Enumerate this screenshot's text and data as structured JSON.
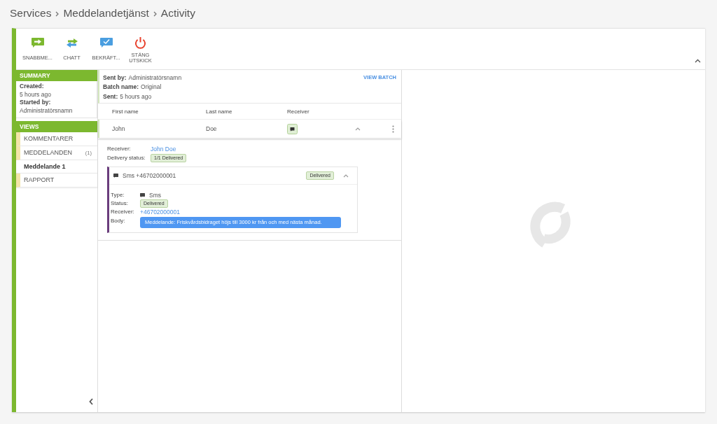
{
  "breadcrumb": [
    {
      "label": "Services"
    },
    {
      "label": "Meddelandetjänst"
    },
    {
      "label": "Activity"
    }
  ],
  "toolbar": {
    "buttons": [
      {
        "label": "SNABBME...",
        "kind": "quick-message"
      },
      {
        "label": "CHATT",
        "kind": "chat"
      },
      {
        "label": "BEKRÄFT...",
        "kind": "confirm"
      },
      {
        "label": "STÄNG UTSKICK",
        "kind": "stop"
      }
    ]
  },
  "sidebar": {
    "summary": {
      "title": "SUMMARY",
      "fields": [
        {
          "label": "Created:",
          "value": "5 hours ago"
        },
        {
          "label": "Started by:",
          "value": "Administratörsnamn"
        }
      ]
    },
    "views": {
      "title": "VIEWS",
      "items": [
        {
          "label": "KOMMENTARER",
          "selected": false
        },
        {
          "label": "MEDDELANDEN",
          "count": "(1)",
          "selected": false,
          "children": [
            {
              "label": "Meddelande 1",
              "selected": true
            }
          ]
        },
        {
          "label": "RAPPORT",
          "selected": false
        }
      ]
    }
  },
  "batch": {
    "fields": [
      {
        "label": "Sent by:",
        "value": "Administratörsnamn"
      },
      {
        "label": "Batch name:",
        "value": "Original"
      },
      {
        "label": "Sent:",
        "value": "5 hours ago"
      }
    ],
    "link": "VIEW BATCH"
  },
  "table": {
    "columns": [
      "First name",
      "Last name",
      "Receiver"
    ],
    "rows": [
      {
        "cells": [
          "John",
          "Doe"
        ],
        "expanded": true
      }
    ]
  },
  "delivery": {
    "fields": [
      {
        "label": "Receiver:",
        "value": "John Doe",
        "kind": "link"
      },
      {
        "label": "Delivery status:",
        "value": "1/1 Delivered",
        "kind": "badge"
      }
    ],
    "messages": [
      {
        "title": "Sms +46702000001",
        "status": "Delivered",
        "expanded": true,
        "fields": [
          {
            "label": "Type:",
            "value": "Sms",
            "kind": "channel"
          },
          {
            "label": "Status:",
            "value": "Delivered",
            "kind": "badge"
          },
          {
            "label": "Receiver:",
            "value": "+46702000001",
            "kind": "link"
          },
          {
            "label": "Body:",
            "value": "Meddelande: Friskvårdsbidraget höjs till 3000 kr från och med nästa månad.",
            "kind": "bubble"
          }
        ]
      }
    ]
  }
}
